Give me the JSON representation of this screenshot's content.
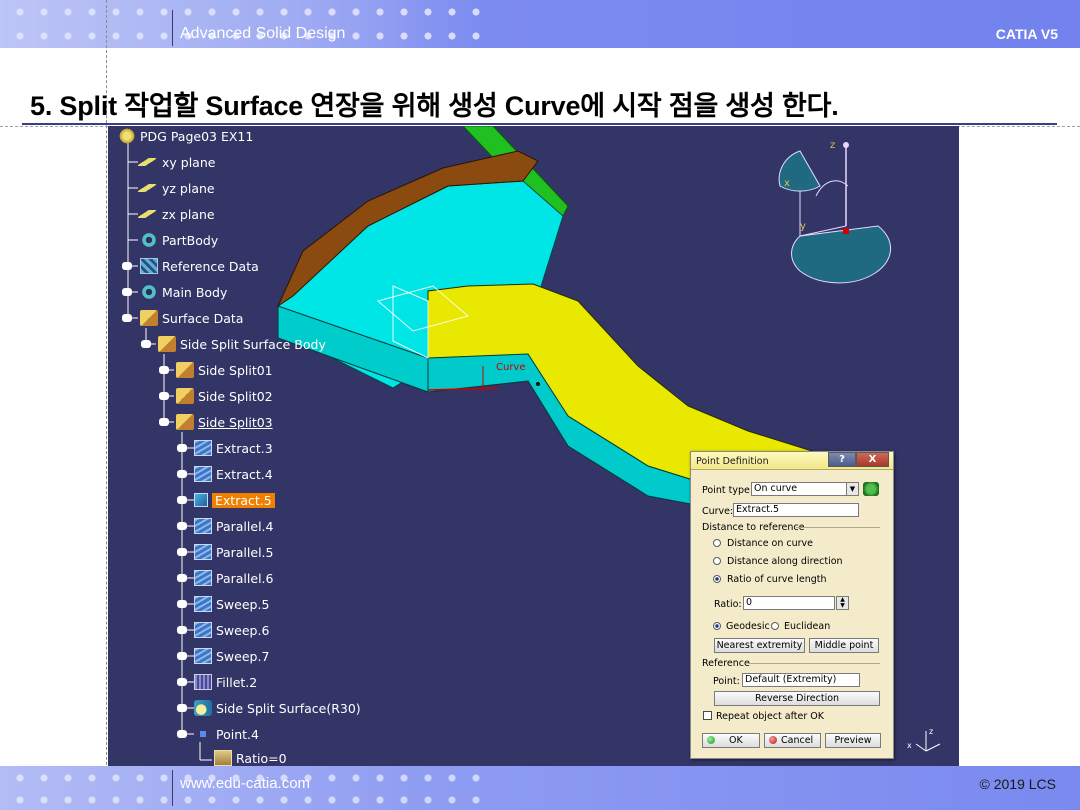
{
  "slide": {
    "header_title": "Advanced Solid Design",
    "header_right": "CATIA V5",
    "heading": "5. Split 작업할 Surface 연장을 위해 생성 Curve에 시작 점을 생성 한다.",
    "footer_left": "www.edu-catia.com",
    "footer_right": "© 2019 LCS"
  },
  "viewport": {
    "curve_label": "Curve",
    "compass_z": "z",
    "compass_x": "x",
    "compass_y": "y",
    "mini_axis_z": "z",
    "mini_axis_x": "x"
  },
  "tree": {
    "root": "PDG Page03 EX11",
    "items": [
      {
        "label": "xy plane",
        "icon": "plane-icon"
      },
      {
        "label": "yz plane",
        "icon": "plane-icon"
      },
      {
        "label": "zx plane",
        "icon": "plane-icon"
      },
      {
        "label": "PartBody",
        "icon": "gear-icon"
      },
      {
        "label": "Reference Data",
        "icon": "body-icon"
      },
      {
        "label": "Main Body",
        "icon": "gear-icon"
      },
      {
        "label": "Surface Data",
        "icon": "geoset-icon"
      },
      {
        "label": "Side Split Surface Body",
        "icon": "geoset-icon"
      },
      {
        "label": "Side Split01",
        "icon": "geoset-icon"
      },
      {
        "label": "Side Split02",
        "icon": "geoset-icon"
      },
      {
        "label": "Side Split03",
        "icon": "geoset-icon"
      },
      {
        "label": "Extract.3",
        "icon": "surface-icon"
      },
      {
        "label": "Extract.4",
        "icon": "surface-icon"
      },
      {
        "label": "Extract.5",
        "icon": "cube-icon"
      },
      {
        "label": "Parallel.4",
        "icon": "surface-icon"
      },
      {
        "label": "Parallel.5",
        "icon": "surface-icon"
      },
      {
        "label": "Parallel.6",
        "icon": "surface-icon"
      },
      {
        "label": "Sweep.5",
        "icon": "surface-icon"
      },
      {
        "label": "Sweep.6",
        "icon": "surface-icon"
      },
      {
        "label": "Sweep.7",
        "icon": "surface-icon"
      },
      {
        "label": "Fillet.2",
        "icon": "fillet-icon"
      },
      {
        "label": "Side Split Surface(R30)",
        "icon": "split-icon"
      },
      {
        "label": "Point.4",
        "icon": "point-icon"
      },
      {
        "label": "Ratio=0",
        "icon": "formula-icon"
      }
    ]
  },
  "dialog": {
    "title": "Point Definition",
    "help": "?",
    "close": "X",
    "point_type_label": "Point type:",
    "point_type_value": "On curve",
    "curve_label": "Curve:",
    "curve_value": "Extract.5",
    "distance_group": "Distance to reference",
    "opt_distance_on_curve": "Distance on curve",
    "opt_distance_along_direction": "Distance along direction",
    "opt_ratio_of_curve_length": "Ratio of curve length",
    "ratio_label": "Ratio:",
    "ratio_value": "0",
    "geodesic": "Geodesic",
    "euclidean": "Euclidean",
    "nearest_extremity": "Nearest extremity",
    "middle_point": "Middle point",
    "reference_group": "Reference",
    "point_label": "Point:",
    "point_value": "Default (Extremity)",
    "reverse_direction": "Reverse Direction",
    "repeat_object": "Repeat object after OK",
    "ok": "OK",
    "cancel": "Cancel",
    "preview": "Preview"
  },
  "colors": {
    "viewport_bg": "#333566",
    "surface_cyan": "#00e6e6",
    "surface_yellow": "#e8e800",
    "surface_brown": "#8a4a10",
    "surface_green": "#20c020",
    "selection_orange": "#f08000",
    "dialog_bg": "#f4ebcb"
  }
}
